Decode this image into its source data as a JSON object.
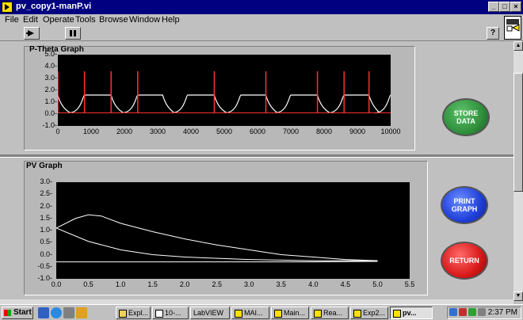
{
  "window": {
    "title": "pv_copy1-manP.vi"
  },
  "menu": [
    "File",
    "Edit",
    "Operate",
    "Tools",
    "Browse",
    "Window",
    "Help"
  ],
  "toolbar": {
    "run_icon": "run-arrow-icon",
    "pause_icon": "pause-icon",
    "help_label": "?"
  },
  "ptheta": {
    "title": "P-Theta Graph",
    "xticks": [
      "0",
      "1000",
      "2000",
      "3000",
      "4000",
      "5000",
      "6000",
      "7000",
      "8000",
      "9000",
      "10000"
    ],
    "yticks": [
      "5.0-",
      "4.0-",
      "3.0-",
      "2.0-",
      "1.0-",
      "0.0-",
      "-1.0-"
    ]
  },
  "pv": {
    "title": "PV Graph",
    "xticks": [
      "0.0",
      "0.5",
      "1.0",
      "1.5",
      "2.0",
      "2.5",
      "3.0",
      "3.5",
      "4.0",
      "4.5",
      "5.0",
      "5.5"
    ],
    "yticks": [
      "3.0-",
      "2.5-",
      "2.0-",
      "1.5-",
      "1.0-",
      "0.5-",
      "0.0-",
      "-0.5-",
      "-1.0-"
    ]
  },
  "buttons": {
    "store": "STORE DATA",
    "print": "PRINT GRAPH",
    "ret": "RETURN"
  },
  "colors": {
    "store": "#2f8f3a",
    "print": "#1f3fd8",
    "ret": "#d81818",
    "plot_bg": "#000000",
    "trace_white": "#ffffff",
    "trace_red": "#ff3030"
  },
  "chart_data": [
    {
      "type": "line",
      "title": "P-Theta Graph",
      "xlim": [
        0,
        10000
      ],
      "ylim": [
        -1.0,
        5.0
      ],
      "series": [
        {
          "values": [
            [
              0,
              1.6
            ],
            [
              800,
              0.1
            ],
            [
              1600,
              1.6
            ],
            [
              2400,
              0.1
            ],
            [
              3150,
              1.6
            ],
            [
              3900,
              0.1
            ],
            [
              4700,
              1.6
            ],
            [
              5500,
              0.1
            ],
            [
              6250,
              1.6
            ],
            [
              7000,
              0.1
            ],
            [
              7800,
              1.6
            ],
            [
              8600,
              0.1
            ],
            [
              9350,
              1.6
            ],
            [
              10000,
              0.1
            ]
          ]
        },
        {
          "values": [
            [
              0,
              3.6
            ],
            [
              800,
              3.6
            ],
            [
              1600,
              3.6
            ],
            [
              2400,
              3.6
            ],
            [
              4700,
              3.6
            ],
            [
              6250,
              3.6
            ],
            [
              7800,
              3.6
            ],
            [
              8600,
              3.6
            ],
            [
              9350,
              3.6
            ]
          ]
        }
      ]
    },
    {
      "type": "line",
      "title": "PV Graph",
      "xlim": [
        0.0,
        5.5
      ],
      "ylim": [
        -1.0,
        3.0
      ],
      "series": [
        {
          "values": [
            [
              0.0,
              1.1
            ],
            [
              0.3,
              1.5
            ],
            [
              0.5,
              1.65
            ],
            [
              0.7,
              1.6
            ],
            [
              1.0,
              1.3
            ],
            [
              1.5,
              0.95
            ],
            [
              2.0,
              0.65
            ],
            [
              2.5,
              0.4
            ],
            [
              3.0,
              0.2
            ],
            [
              3.5,
              0.0
            ],
            [
              4.0,
              -0.1
            ],
            [
              4.5,
              -0.2
            ],
            [
              5.0,
              -0.25
            ]
          ]
        },
        {
          "values": [
            [
              0.0,
              1.1
            ],
            [
              0.5,
              0.55
            ],
            [
              1.0,
              0.2
            ],
            [
              1.5,
              0.0
            ],
            [
              2.0,
              -0.1
            ],
            [
              3.0,
              -0.2
            ],
            [
              4.0,
              -0.25
            ],
            [
              5.0,
              -0.25
            ]
          ]
        },
        {
          "values": [
            [
              0.0,
              -0.3
            ],
            [
              1.0,
              -0.3
            ],
            [
              2.0,
              -0.3
            ],
            [
              3.0,
              -0.3
            ],
            [
              4.0,
              -0.3
            ],
            [
              5.0,
              -0.28
            ]
          ]
        }
      ]
    }
  ],
  "taskbar": {
    "start": "Start",
    "tasks": [
      "Expl...",
      "10-...",
      "LabVIEW",
      "MAI...",
      "Main...",
      "Rea...",
      "Exp2...",
      "pv..."
    ],
    "clock": "2:37 PM"
  }
}
